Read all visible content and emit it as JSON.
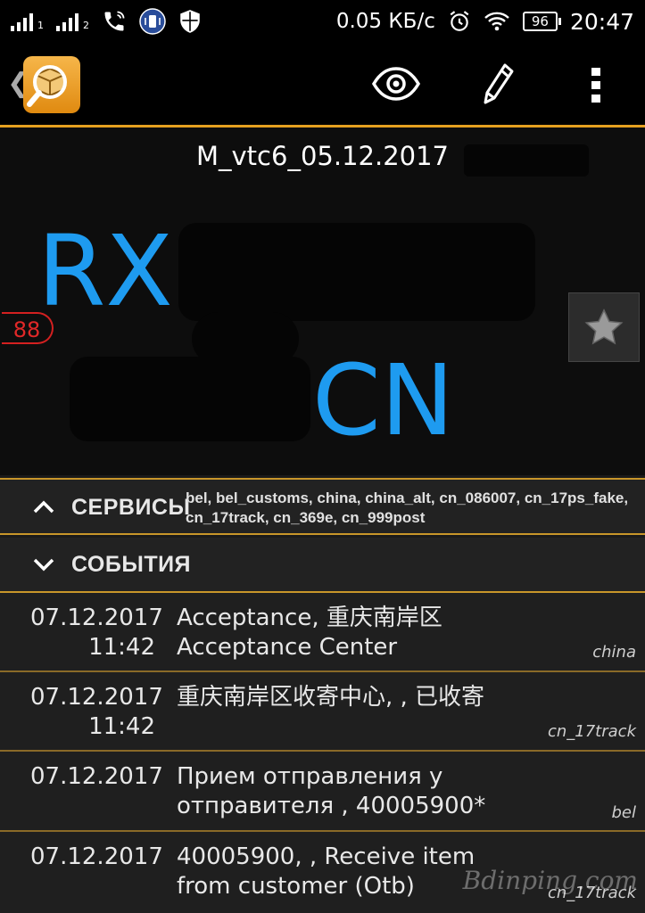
{
  "status_bar": {
    "sim1": "1",
    "sim2": "2",
    "net_speed": "0.05 КБ/с",
    "battery": "96",
    "time": "20:47"
  },
  "toolbar": {
    "icons": [
      "back-chevron",
      "app-logo",
      "eye-icon",
      "pencil-icon",
      "more-vert-icon"
    ]
  },
  "parcel": {
    "name": "M_vtc6_05.12.2017",
    "number_prefix": "RX",
    "number_suffix": "CN",
    "badge": "88"
  },
  "sections": {
    "services": {
      "label": "СЕРВИСЫ",
      "list": "bel, bel_customs, china, china_alt, cn_086007, cn_17ps_fake, cn_17track, cn_369e, cn_999post"
    },
    "events": {
      "label": "СОБЫТИЯ"
    }
  },
  "events": [
    {
      "date": "07.12.2017",
      "time": "11:42",
      "text": "Acceptance, 重庆南岸区 Acceptance Center",
      "source": "china"
    },
    {
      "date": "07.12.2017",
      "time": "11:42",
      "text": "重庆南岸区收寄中心, , 已收寄",
      "source": "cn_17track"
    },
    {
      "date": "07.12.2017",
      "time": "",
      "text": "Прием отправления у отправителя , 40005900*",
      "source": "bel"
    },
    {
      "date": "07.12.2017",
      "time": "",
      "text": "40005900, , Receive item from customer (Otb)",
      "source": "cn_17track"
    }
  ],
  "watermark": "Bdinping.com",
  "colors": {
    "accent": "#e5a020",
    "number": "#1e9bf0",
    "badge": "#e02828"
  }
}
